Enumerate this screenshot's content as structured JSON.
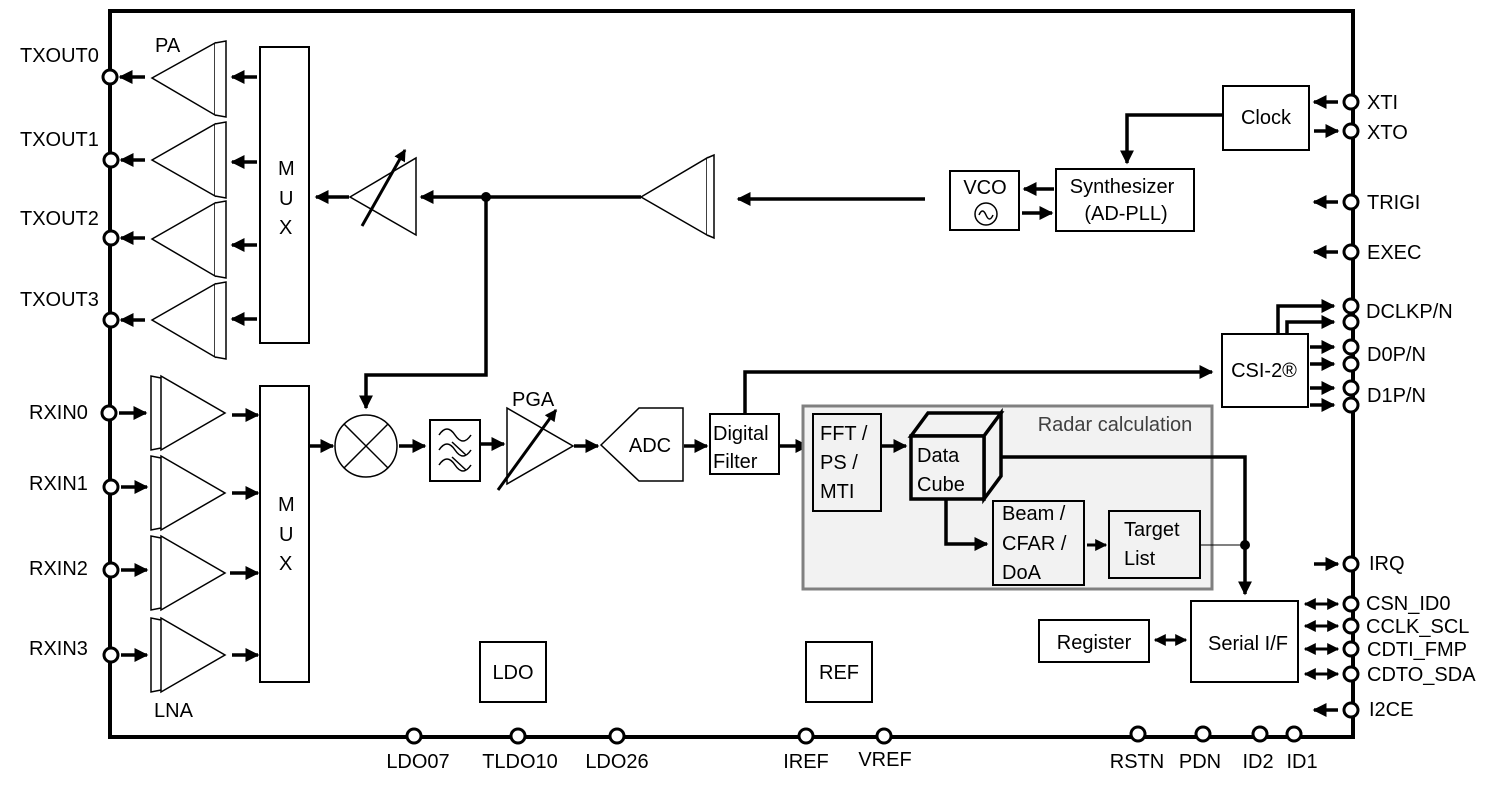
{
  "diagram": {
    "title": "",
    "left_pins": {
      "tx": [
        "TXOUT0",
        "TXOUT1",
        "TXOUT2",
        "TXOUT3"
      ],
      "rx": [
        "RXIN0",
        "RXIN1",
        "RXIN2",
        "RXIN3"
      ]
    },
    "right_pins": [
      "XTI",
      "XTO",
      "TRIGI",
      "EXEC",
      "DCLKP/N",
      "D0P/N",
      "D1P/N",
      "IRQ",
      "CSN_ID0",
      "CCLK_SCL",
      "CDTI_FMP",
      "CDTO_SDA",
      "I2CE"
    ],
    "bottom_pins": [
      "LDO07",
      "TLDO10",
      "LDO26",
      "IREF",
      "VREF",
      "RSTN",
      "PDN",
      "ID2",
      "ID1"
    ],
    "labels": {
      "pa": "PA",
      "lna": "LNA",
      "pga": "PGA",
      "mux_letters": [
        "M",
        "U",
        "X"
      ]
    },
    "blocks": {
      "clock": "Clock",
      "vco": "VCO",
      "synth_line1": "Synthesizer",
      "synth_line2": "(AD-PLL)",
      "adc": "ADC",
      "digital_filter_1": "Digital",
      "digital_filter_2": "Filter",
      "csi2": "CSI-2®",
      "radar_group": "Radar calculation",
      "fft_1": "FFT /",
      "fft_2": "PS /",
      "fft_3": "MTI",
      "cube_1": "Data",
      "cube_2": "Cube",
      "beam_1": "Beam /",
      "beam_2": "CFAR /",
      "beam_3": "DoA",
      "target_1": "Target",
      "target_2": "List",
      "register": "Register",
      "serial": "Serial I/F",
      "ldo": "LDO",
      "ref": "REF"
    },
    "colors": {
      "line": "#000000",
      "radar_group_fill": "#f2f2f2",
      "radar_group_border": "#808080",
      "radar_group_text": "#404040"
    }
  }
}
